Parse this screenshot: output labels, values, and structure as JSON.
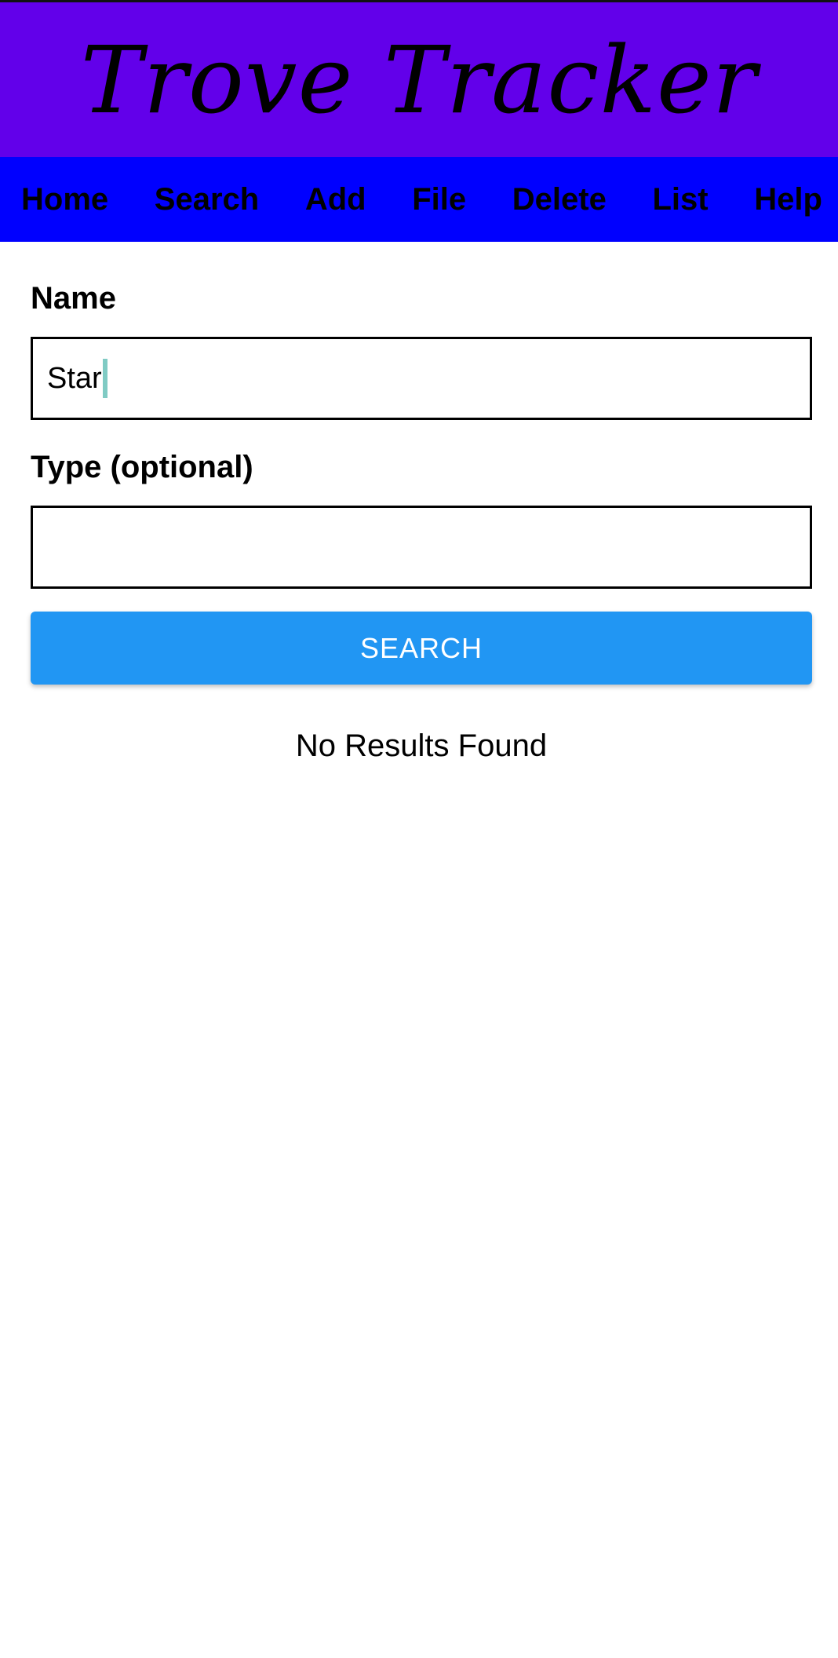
{
  "app": {
    "title": "Trove Tracker",
    "colors": {
      "title_bar": "#6200EA",
      "nav_bar": "#0000FF",
      "button": "#2196F3",
      "caret": "#80CBC4"
    }
  },
  "nav": {
    "items": [
      {
        "label": "Home"
      },
      {
        "label": "Search"
      },
      {
        "label": "Add"
      },
      {
        "label": "File"
      },
      {
        "label": "Delete"
      },
      {
        "label": "List"
      },
      {
        "label": "Help"
      }
    ]
  },
  "form": {
    "name": {
      "label": "Name",
      "value": "Star"
    },
    "type": {
      "label": "Type (optional)",
      "value": ""
    },
    "search_button_label": "SEARCH"
  },
  "results": {
    "message": "No Results Found"
  }
}
